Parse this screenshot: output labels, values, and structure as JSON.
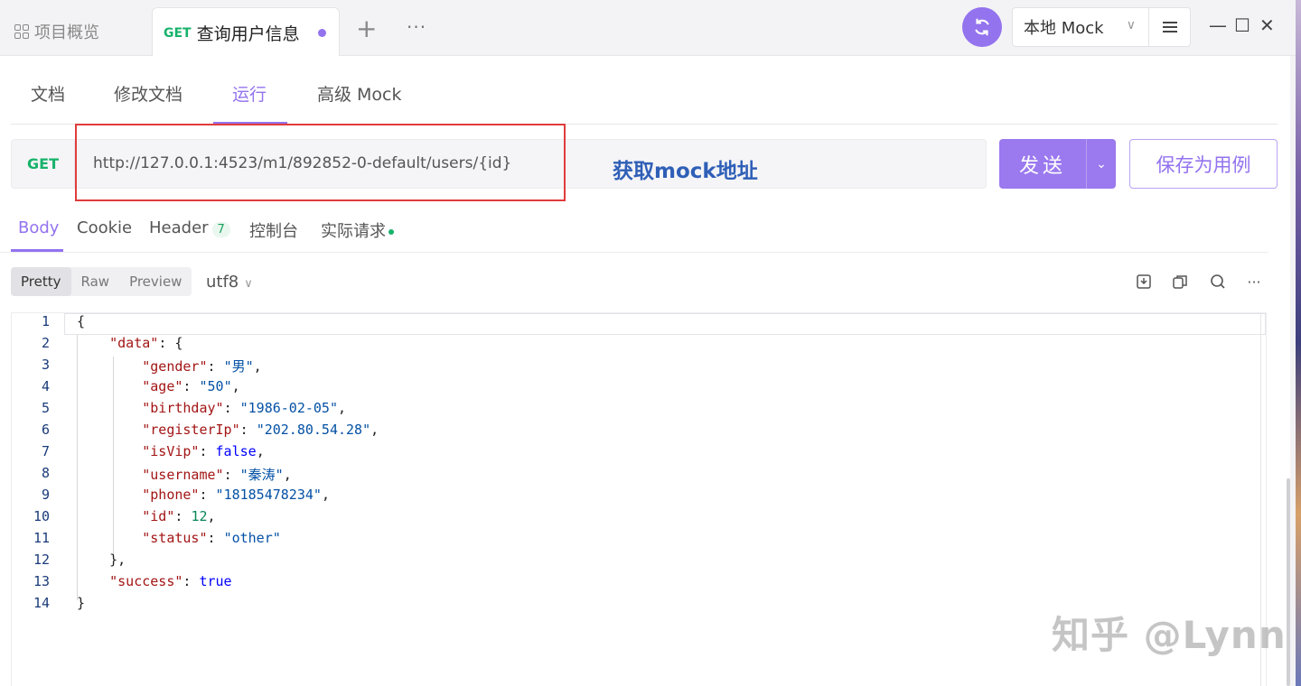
{
  "titlebar": {
    "project_tab": "项目概览",
    "active_tab": {
      "method": "GET",
      "name": "查询用户信息"
    },
    "add_tab": "+",
    "more": "···",
    "env": "本地 Mock",
    "env_chevron": "∨",
    "minimize": "—",
    "maximize": "☐",
    "close": "✕"
  },
  "doc_tabs": [
    "文档",
    "修改文档",
    "运行",
    "高级 Mock"
  ],
  "request": {
    "method": "GET",
    "url": "http://127.0.0.1:4523/m1/892852-0-default/users/{id}",
    "annotation": "获取mock地址",
    "send": "发送",
    "send_dropdown": "⌄",
    "save_case": "保存为用例"
  },
  "response_tabs": {
    "body": "Body",
    "cookie": "Cookie",
    "header": "Header",
    "header_count": "7",
    "console": "控制台",
    "actual_request": "实际请求"
  },
  "format": {
    "pretty": "Pretty",
    "raw": "Raw",
    "preview": "Preview",
    "encoding": "utf8"
  },
  "colors": {
    "accent": "#9373ee",
    "method_green": "#17b26a",
    "annotation_blue": "#2f5fb7",
    "red_box": "#e03c3c"
  },
  "code_lines": [
    "1",
    "2",
    "3",
    "4",
    "5",
    "6",
    "7",
    "8",
    "9",
    "10",
    "11",
    "12",
    "13",
    "14"
  ],
  "json_body": {
    "gender": "男",
    "age": "50",
    "birthday": "1986-02-05",
    "registerIp": "202.80.54.28",
    "isVip": "false",
    "username": "秦涛",
    "phone": "18185478234",
    "id": "12",
    "status": "other",
    "success": "true"
  },
  "watermark": "知乎 @Lynn"
}
